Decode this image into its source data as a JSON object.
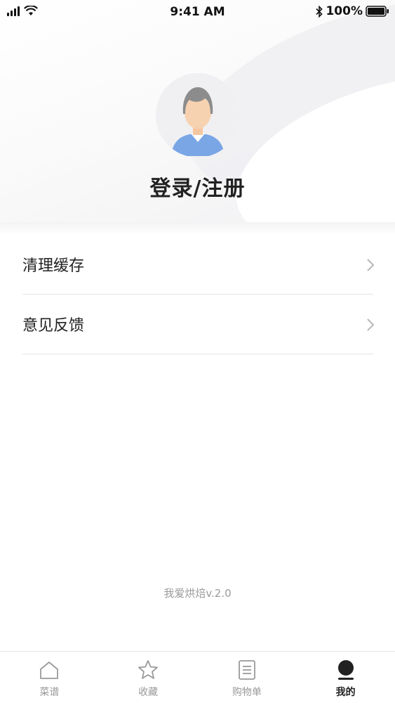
{
  "status_bar": {
    "time": "9:41 AM",
    "battery": "100%"
  },
  "profile": {
    "login_label": "登录/注册"
  },
  "menu": {
    "items": [
      {
        "label": "清理缓存"
      },
      {
        "label": "意见反馈"
      }
    ]
  },
  "footer": {
    "version": "我爱烘焙v.2.0"
  },
  "tabbar": {
    "tabs": [
      {
        "label": "菜谱",
        "icon": "home-icon",
        "active": false
      },
      {
        "label": "收藏",
        "icon": "star-icon",
        "active": false
      },
      {
        "label": "购物单",
        "icon": "list-icon",
        "active": false
      },
      {
        "label": "我的",
        "icon": "profile-icon",
        "active": true
      }
    ]
  },
  "colors": {
    "active_tab": "#222222",
    "inactive_tab": "#999999",
    "avatar_shirt": "#7aa6e6"
  }
}
